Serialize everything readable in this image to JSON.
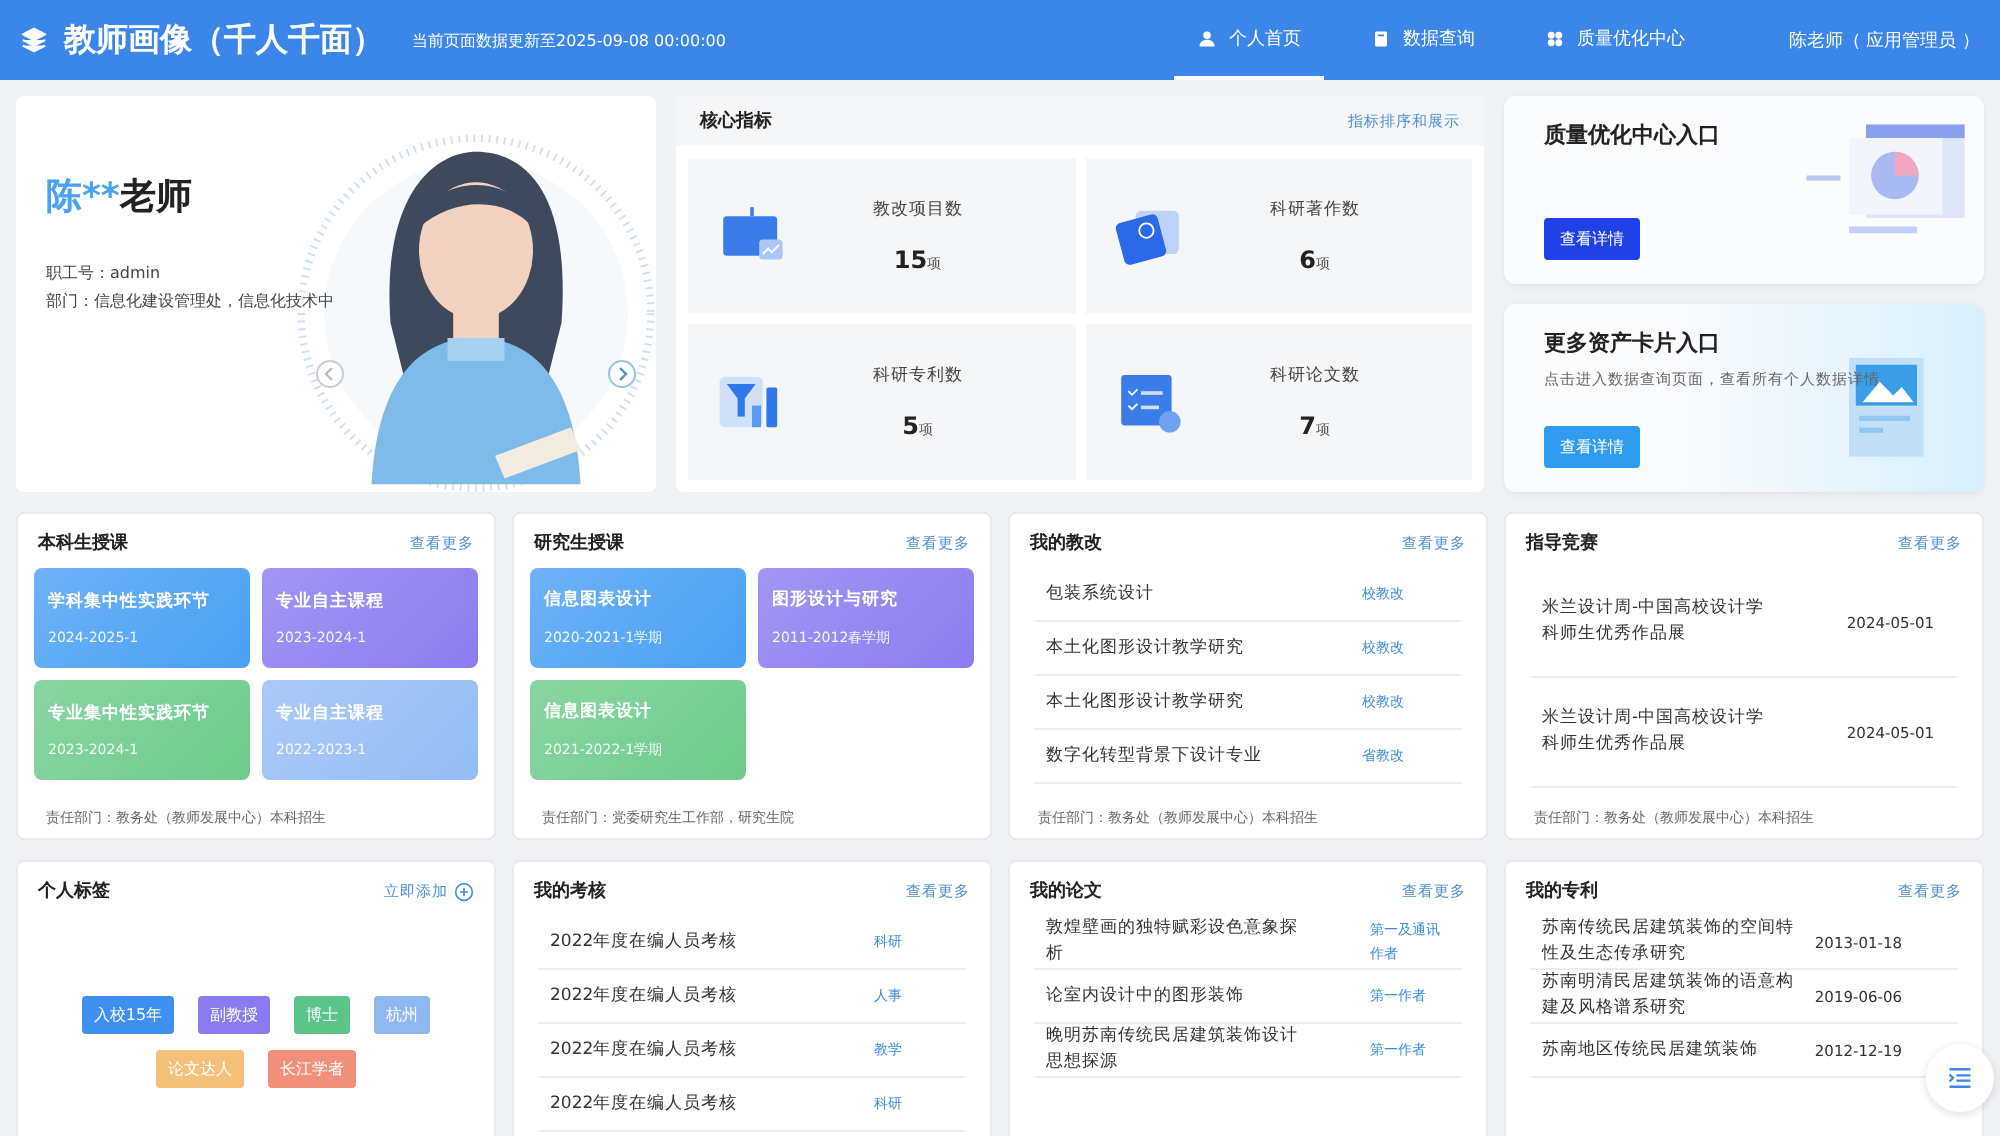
{
  "header": {
    "title": "教师画像（千人千面）",
    "update_note": "当前页面数据更新至2025-09-08 00:00:00",
    "nav": [
      {
        "label": "个人首页",
        "selected": true
      },
      {
        "label": "数据查询",
        "selected": false
      },
      {
        "label": "质量优化中心",
        "selected": false
      }
    ],
    "user": "陈老师（ 应用管理员 ）"
  },
  "profile": {
    "name_highlight": "陈**",
    "name_rest": "老师",
    "staff_id": "职工号：admin",
    "department": "部门：信息化建设管理处，信息化技术中"
  },
  "core_metrics": {
    "title": "核心指标",
    "action": "指标排序和展示",
    "items": [
      {
        "label": "教改项目数",
        "value": "15",
        "unit": "项"
      },
      {
        "label": "科研著作数",
        "value": "6",
        "unit": "项"
      },
      {
        "label": "科研专利数",
        "value": "5",
        "unit": "项"
      },
      {
        "label": "科研论文数",
        "value": "7",
        "unit": "项"
      }
    ]
  },
  "entries": [
    {
      "kind": "quality",
      "title": "质量优化中心入口",
      "button": "查看详情"
    },
    {
      "kind": "assets",
      "title": "更多资产卡片入口",
      "description": "点击进入数据查询页面，查看所有个人数据详情",
      "button": "查看详情"
    }
  ],
  "undergraduate_courses": {
    "title": "本科生授课",
    "more": "查看更多",
    "courses": [
      {
        "name": "学科集中性实践环节",
        "term": "2024-2025-1",
        "color": "#4a9ff5"
      },
      {
        "name": "专业自主课程",
        "term": "2023-2024-1",
        "color": "#8b7cf0"
      },
      {
        "name": "专业集中性实践环节",
        "term": "2023-2024-1",
        "color": "#6ccb8c"
      },
      {
        "name": "专业自主课程",
        "term": "2022-2023-1",
        "color": "#94bdf5"
      }
    ],
    "footer": "责任部门：教务处（教师发展中心）本科招生"
  },
  "graduate_courses": {
    "title": "研究生授课",
    "more": "查看更多",
    "courses": [
      {
        "name": "信息图表设计",
        "term": "2020-2021-1学期",
        "color": "#4a9ff5"
      },
      {
        "name": "图形设计与研究",
        "term": "2011-2012春学期",
        "color": "#8b7cf0"
      },
      {
        "name": "信息图表设计",
        "term": "2021-2022-1学期",
        "color": "#6ccb8c"
      }
    ],
    "footer": "责任部门：党委研究生工作部，研究生院"
  },
  "teaching_reform": {
    "title": "我的教改",
    "more": "查看更多",
    "items": [
      {
        "name": "包装系统设计",
        "tag": "校教改"
      },
      {
        "name": "本土化图形设计教学研究",
        "tag": "校教改"
      },
      {
        "name": "本土化图形设计教学研究",
        "tag": "校教改"
      },
      {
        "name": "数字化转型背景下设计专业",
        "tag": "省教改"
      }
    ],
    "footer": "责任部门：教务处（教师发展中心）本科招生"
  },
  "competitions": {
    "title": "指导竞赛",
    "more": "查看更多",
    "items": [
      {
        "name": "米兰设计周-中国高校设计学科师生优秀作品展",
        "date": "2024-05-01"
      },
      {
        "name": "米兰设计周-中国高校设计学科师生优秀作品展",
        "date": "2024-05-01"
      }
    ],
    "footer": "责任部门：教务处（教师发展中心）本科招生"
  },
  "tags": {
    "title": "个人标签",
    "action": "立即添加",
    "items": [
      {
        "label": "入校15年",
        "color": "#3d8ff0"
      },
      {
        "label": "副教授",
        "color": "#8a7cf0"
      },
      {
        "label": "博士",
        "color": "#5cc48a"
      },
      {
        "label": "杭州",
        "color": "#8fb8f0"
      },
      {
        "label": "论文达人",
        "color": "#f5c07a"
      },
      {
        "label": "长江学者",
        "color": "#f0907a"
      }
    ]
  },
  "assessments": {
    "title": "我的考核",
    "more": "查看更多",
    "items": [
      {
        "name": "2022年度在编人员考核",
        "tag": "科研"
      },
      {
        "name": "2022年度在编人员考核",
        "tag": "人事"
      },
      {
        "name": "2022年度在编人员考核",
        "tag": "教学"
      },
      {
        "name": "2022年度在编人员考核",
        "tag": "科研"
      }
    ]
  },
  "papers": {
    "title": "我的论文",
    "more": "查看更多",
    "items": [
      {
        "name": "敦煌壁画的独特赋彩设色意象探析",
        "tag": "第一及通讯作者"
      },
      {
        "name": "论室内设计中的图形装饰",
        "tag": "第一作者"
      },
      {
        "name": "晚明苏南传统民居建筑装饰设计思想探源",
        "tag": "第一作者"
      }
    ]
  },
  "patents": {
    "title": "我的专利",
    "more": "查看更多",
    "items": [
      {
        "name": "苏南传统民居建筑装饰的空间特性及生态传承研究",
        "date": "2013-01-18"
      },
      {
        "name": "苏南明清民居建筑装饰的语意构建及风格谱系研究",
        "date": "2019-06-06"
      },
      {
        "name": "苏南地区传统民居建筑装饰",
        "date": "2012-12-19"
      }
    ]
  }
}
